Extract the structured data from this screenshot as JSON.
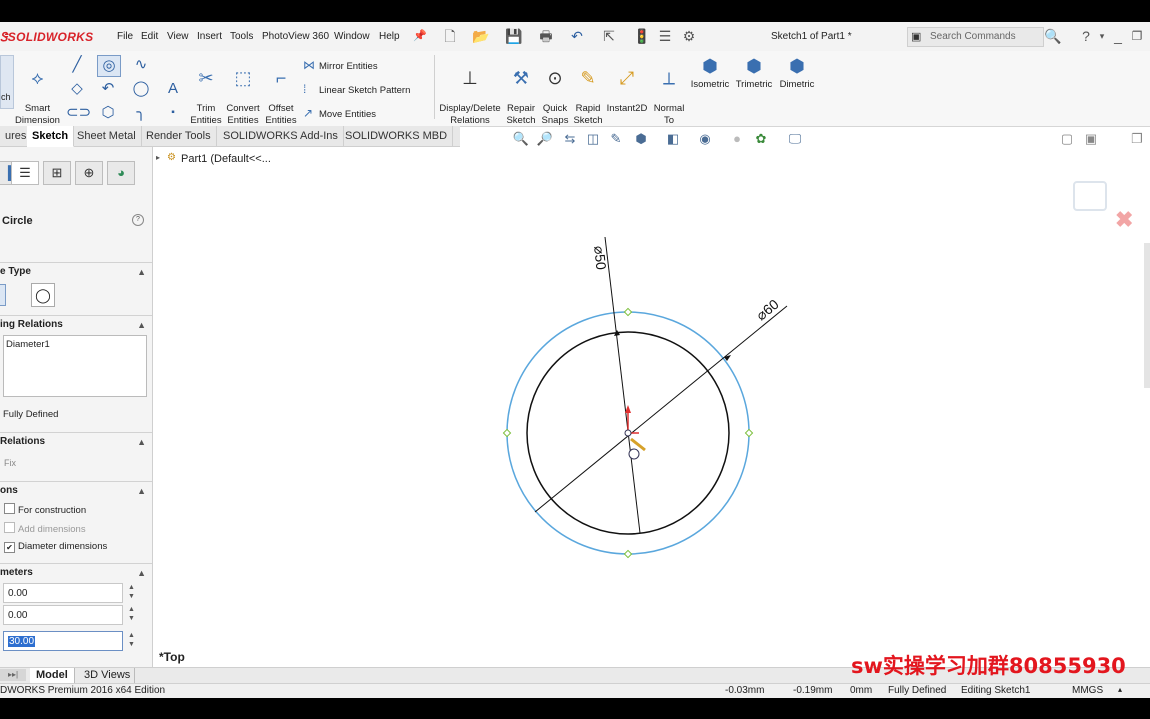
{
  "app": {
    "logo": "SOLIDWORKS",
    "menu": [
      "File",
      "Edit",
      "View",
      "Insert",
      "Tools",
      "PhotoView 360",
      "Window",
      "Help"
    ],
    "document_title": "Sketch1 of Part1 *",
    "search_placeholder": "Search Commands"
  },
  "command_manager": {
    "smart_dimension": "Smart\nDimension",
    "sketch": "ch",
    "trim": "Trim\nEntities",
    "convert": "Convert\nEntities",
    "offset": "Offset\nEntities",
    "mirror": "Mirror Entities",
    "linear_pattern": "Linear Sketch Pattern",
    "move": "Move Entities",
    "display_delete": "Display/Delete\nRelations",
    "repair": "Repair\nSketch",
    "quick_snaps": "Quick\nSnaps",
    "rapid_sketch": "Rapid\nSketch",
    "instant2d": "Instant2D",
    "normal_to": "Normal\nTo",
    "isometric": "Isometric",
    "trimetric": "Trimetric",
    "dimetric": "Dimetric"
  },
  "tabs": [
    "ures",
    "Sketch",
    "Sheet Metal",
    "Render Tools",
    "SOLIDWORKS Add-Ins",
    "SOLIDWORKS MBD"
  ],
  "active_tab": "Sketch",
  "feature_tree": {
    "root": "Part1  (Default<<..."
  },
  "property_manager": {
    "title": "Circle",
    "type_section": "e Type",
    "existing_relations_section": "ing Relations",
    "existing_relations": [
      "Diameter1"
    ],
    "status": "Fully Defined",
    "add_relations_section": "Relations",
    "add_relation_fix": "Fix",
    "options_section": "ons",
    "for_construction": "For construction",
    "add_dimensions": "Add dimensions",
    "diameter_dimensions": "Diameter dimensions",
    "parameters_section": "meters",
    "param_x": "0.00",
    "param_y": "0.00",
    "param_r": "30.00"
  },
  "graphics": {
    "dim_inner": "50",
    "dim_outer": "60",
    "view_label": "*Top"
  },
  "bottom_tabs": [
    "Model",
    "3D Views"
  ],
  "status_bar": {
    "edition": "DWORKS Premium 2016 x64 Edition",
    "x": "-0.03mm",
    "y": "-0.19mm",
    "z": "0mm",
    "state": "Fully Defined",
    "editing": "Editing Sketch1",
    "units": "MMGS"
  },
  "watermark": "sw实操学习加群80855930",
  "colors": {
    "accent_red": "#d8232a",
    "selected_circle": "#5aa7dd",
    "highlight_field": "#2e6fd0",
    "watermark": "#e3161e"
  }
}
